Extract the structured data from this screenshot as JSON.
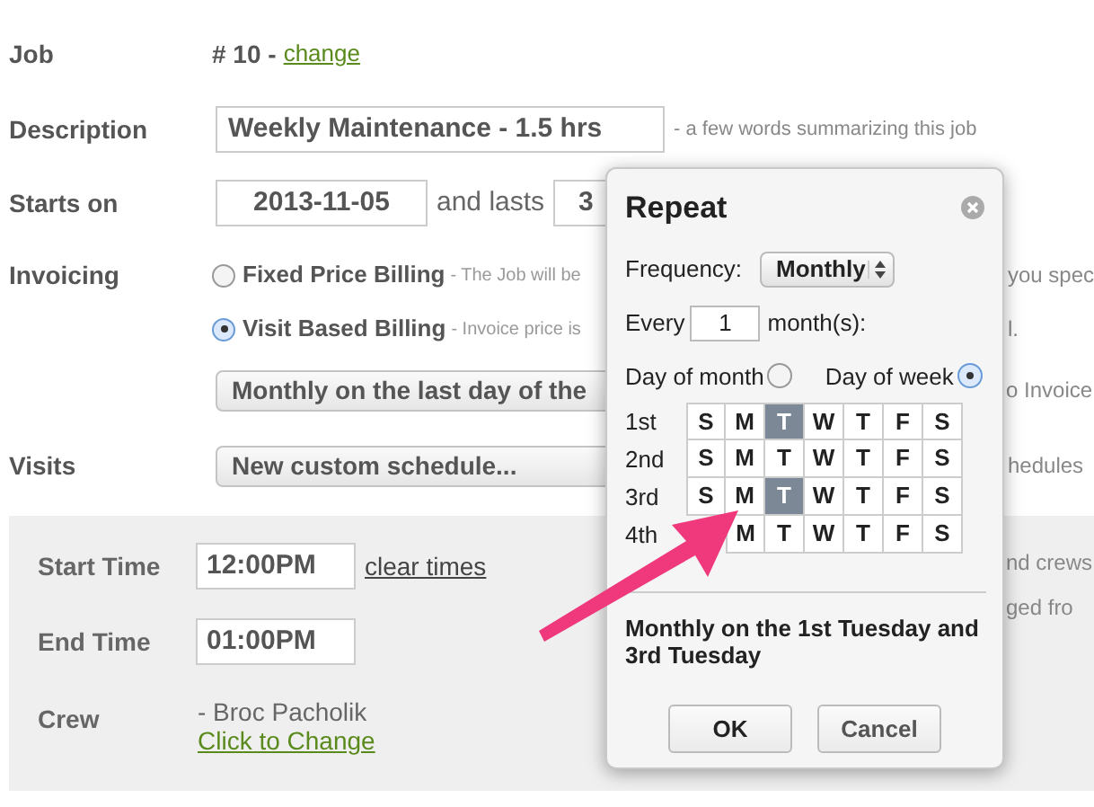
{
  "job": {
    "label": "Job",
    "number": "# 10 -",
    "change_link": "change"
  },
  "description": {
    "label": "Description",
    "value": "Weekly Maintenance - 1.5 hrs",
    "hint": "- a few words summarizing this job"
  },
  "starts_on": {
    "label": "Starts on",
    "date": "2013-11-05",
    "and_lasts": "and lasts",
    "duration": "3"
  },
  "invoicing": {
    "label": "Invoicing",
    "options": [
      {
        "name": "Fixed Price Billing",
        "note": "- The Job will be",
        "note_tail": "you spec",
        "selected": false
      },
      {
        "name": "Visit Based Billing",
        "note": "- Invoice price is",
        "note_tail": "l.",
        "selected": true
      }
    ],
    "schedule": "Monthly on the last day of the",
    "schedule_tail": "o Invoice"
  },
  "visits": {
    "label": "Visits",
    "schedule": "New custom schedule...",
    "schedule_tail": "hedules"
  },
  "visit_panel": {
    "start_time": {
      "label": "Start Time",
      "value": "12:00PM",
      "link": "clear times"
    },
    "end_time": {
      "label": "End Time",
      "value": "01:00PM"
    },
    "crew": {
      "label": "Crew",
      "member": "- Broc Pacholik",
      "link": "Click to Change"
    },
    "tails": [
      "nd crews",
      "ged fro"
    ]
  },
  "repeat_dialog": {
    "title": "Repeat",
    "frequency_label": "Frequency:",
    "frequency": "Monthly",
    "every_label": "Every",
    "every_value": "1",
    "every_unit": "month(s):",
    "modes": [
      {
        "label": "Day of month",
        "selected": false
      },
      {
        "label": "Day of week",
        "selected": true
      }
    ],
    "weeks": [
      {
        "label": "1st",
        "days": [
          {
            "label": "S",
            "selected": false
          },
          {
            "label": "M",
            "selected": false
          },
          {
            "label": "T",
            "selected": true
          },
          {
            "label": "W",
            "selected": false
          },
          {
            "label": "T",
            "selected": false
          },
          {
            "label": "F",
            "selected": false
          },
          {
            "label": "S",
            "selected": false
          }
        ]
      },
      {
        "label": "2nd",
        "days": [
          {
            "label": "S",
            "selected": false
          },
          {
            "label": "M",
            "selected": false
          },
          {
            "label": "T",
            "selected": false
          },
          {
            "label": "W",
            "selected": false
          },
          {
            "label": "T",
            "selected": false
          },
          {
            "label": "F",
            "selected": false
          },
          {
            "label": "S",
            "selected": false
          }
        ]
      },
      {
        "label": "3rd",
        "days": [
          {
            "label": "S",
            "selected": false
          },
          {
            "label": "M",
            "selected": false
          },
          {
            "label": "T",
            "selected": true
          },
          {
            "label": "W",
            "selected": false
          },
          {
            "label": "T",
            "selected": false
          },
          {
            "label": "F",
            "selected": false
          },
          {
            "label": "S",
            "selected": false
          }
        ]
      },
      {
        "label": "4th",
        "days": [
          {
            "label": "M",
            "selected": false
          },
          {
            "label": "T",
            "selected": false
          },
          {
            "label": "W",
            "selected": false
          },
          {
            "label": "T",
            "selected": false
          },
          {
            "label": "F",
            "selected": false
          },
          {
            "label": "S",
            "selected": false
          }
        ]
      }
    ],
    "summary": "Monthly on the 1st Tuesday and 3rd Tuesday",
    "buttons": [
      "OK",
      "Cancel"
    ]
  }
}
